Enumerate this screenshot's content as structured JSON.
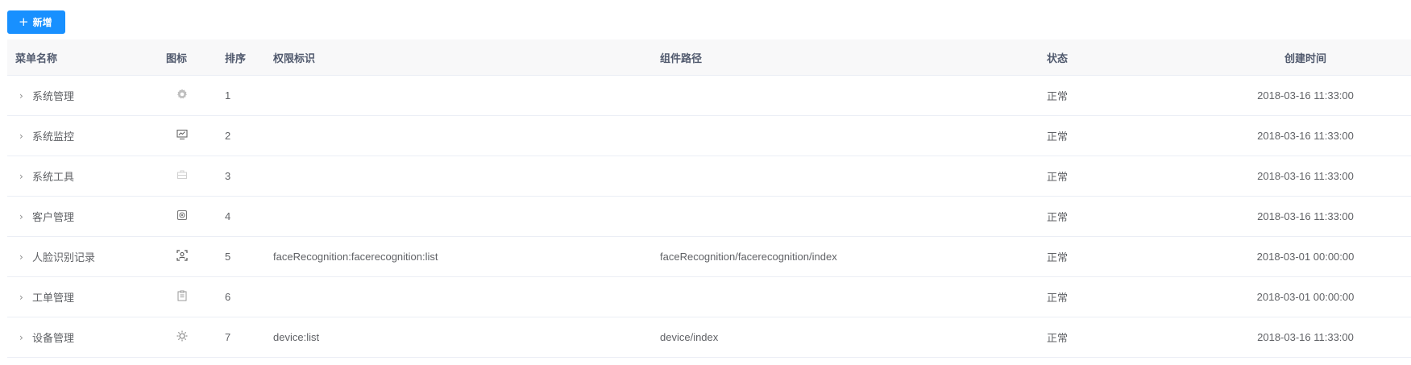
{
  "toolbar": {
    "add_label": "新增"
  },
  "table": {
    "headers": {
      "name": "菜单名称",
      "icon": "图标",
      "sort": "排序",
      "perm": "权限标识",
      "component": "组件路径",
      "status": "状态",
      "created": "创建时间"
    },
    "rows": [
      {
        "name": "系统管理",
        "icon": "gear-icon",
        "sort": "1",
        "perm": "",
        "component": "",
        "status": "正常",
        "created": "2018-03-16 11:33:00"
      },
      {
        "name": "系统监控",
        "icon": "monitor-icon",
        "sort": "2",
        "perm": "",
        "component": "",
        "status": "正常",
        "created": "2018-03-16 11:33:00"
      },
      {
        "name": "系统工具",
        "icon": "toolbox-icon",
        "sort": "3",
        "perm": "",
        "component": "",
        "status": "正常",
        "created": "2018-03-16 11:33:00"
      },
      {
        "name": "客户管理",
        "icon": "customer-icon",
        "sort": "4",
        "perm": "",
        "component": "",
        "status": "正常",
        "created": "2018-03-16 11:33:00"
      },
      {
        "name": "人脸识别记录",
        "icon": "face-scan-icon",
        "sort": "5",
        "perm": "faceRecognition:facerecognition:list",
        "component": "faceRecognition/facerecognition/index",
        "status": "正常",
        "created": "2018-03-01 00:00:00"
      },
      {
        "name": "工单管理",
        "icon": "clipboard-icon",
        "sort": "6",
        "perm": "",
        "component": "",
        "status": "正常",
        "created": "2018-03-01 00:00:00"
      },
      {
        "name": "设备管理",
        "icon": "device-icon",
        "sort": "7",
        "perm": "device:list",
        "component": "device/index",
        "status": "正常",
        "created": "2018-03-16 11:33:00"
      }
    ]
  }
}
